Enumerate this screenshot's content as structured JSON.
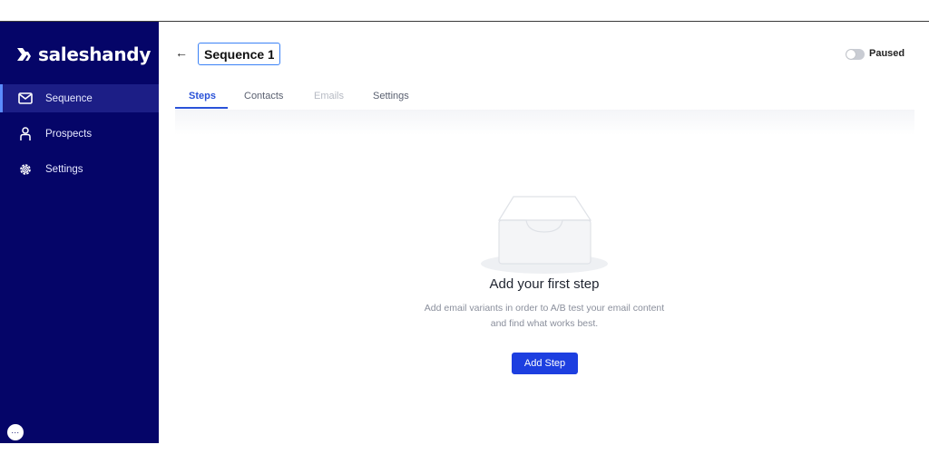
{
  "brand": {
    "name": "saleshandy",
    "sidebar_bg": "#050568",
    "accent": "#1d3fe0"
  },
  "sidebar": {
    "items": [
      {
        "label": "Sequence",
        "icon": "mail-icon",
        "active": true
      },
      {
        "label": "Prospects",
        "icon": "person-icon",
        "active": false
      },
      {
        "label": "Settings",
        "icon": "gear-icon",
        "active": false
      }
    ],
    "chat_icon": "chat-bubble-icon"
  },
  "header": {
    "back_icon": "arrow-left-icon",
    "sequence_name": "Sequence 1",
    "status": {
      "label": "Paused",
      "on": false
    }
  },
  "tabs": [
    {
      "label": "Steps",
      "active": true
    },
    {
      "label": "Contacts",
      "active": false
    },
    {
      "label": "Emails",
      "active": false,
      "disabled": true
    },
    {
      "label": "Settings",
      "active": false
    }
  ],
  "empty_state": {
    "illustration": "empty-inbox-illustration",
    "title": "Add your first step",
    "description_line1": "Add email variants in order to A/B test your email content",
    "description_line2": "and find what works best.",
    "button_label": "Add Step"
  }
}
